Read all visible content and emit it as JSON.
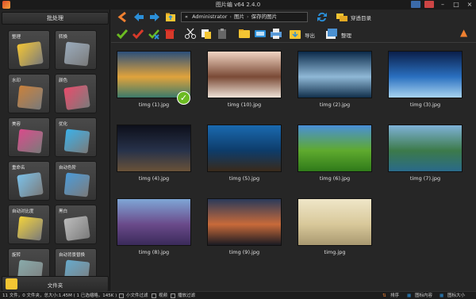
{
  "window": {
    "title": "图片编 v64 2.4.0"
  },
  "left_panel": {
    "header": "批处理",
    "tools": [
      {
        "label": "整理",
        "icon": "photos-stack-icon"
      },
      {
        "label": "转换",
        "icon": "convert-icon"
      },
      {
        "label": "水印",
        "icon": "watermark-stamp-icon"
      },
      {
        "label": "颜色",
        "icon": "color-balls-icon"
      },
      {
        "label": "美容",
        "icon": "cosmetics-icon"
      },
      {
        "label": "优化",
        "icon": "optimize-photo-icon"
      },
      {
        "label": "重命名",
        "icon": "rename-icon"
      },
      {
        "label": "自动色阶",
        "icon": "levels-chart-icon"
      },
      {
        "label": "自动对比度",
        "icon": "contrast-sun-icon"
      },
      {
        "label": "黑白",
        "icon": "grayscale-photo-icon"
      },
      {
        "label": "旋转",
        "icon": "rotate-icon"
      },
      {
        "label": "自动背景替换",
        "icon": "background-replace-icon"
      }
    ],
    "folder_label": "文件夹"
  },
  "toolbar": {
    "path": {
      "prefix": "«",
      "root": "Administrator",
      "parts": [
        "图片",
        "保存的图片"
      ]
    },
    "through_label": "穿透目录",
    "export_label": "导出",
    "organize_label": "整理"
  },
  "thumbnails": [
    {
      "name": "timg (1).jpg",
      "checked": true,
      "c1": "#2b4f7a",
      "c2": "#e0a33c",
      "c3": "#3c7a6a"
    },
    {
      "name": "timg (10).jpg",
      "checked": false,
      "c1": "#f2d6c4",
      "c2": "#7a4a36",
      "c3": "#efe3d8"
    },
    {
      "name": "timg (2).jpg",
      "checked": false,
      "c1": "#0b2a4a",
      "c2": "#8fb8d6",
      "c3": "#12304c"
    },
    {
      "name": "timg (3).jpg",
      "checked": false,
      "c1": "#0a1f4a",
      "c2": "#2a70c0",
      "c3": "#a8d4f0"
    },
    {
      "name": "timg (4).jpg",
      "checked": false,
      "c1": "#0d0f1a",
      "c2": "#27324a",
      "c3": "#6a5238"
    },
    {
      "name": "timg (5).jpg",
      "checked": false,
      "c1": "#1a6ab0",
      "c2": "#0d3c6a",
      "c3": "#3a2a1a"
    },
    {
      "name": "timg (6).jpg",
      "checked": false,
      "c1": "#4a8fd8",
      "c2": "#5faa2e",
      "c3": "#2f7a1a"
    },
    {
      "name": "timg (7).jpg",
      "checked": false,
      "c1": "#7fb2d8",
      "c2": "#3c7a4a",
      "c3": "#2a6a8a"
    },
    {
      "name": "timg (8).jpg",
      "checked": false,
      "c1": "#7fa6d6",
      "c2": "#6a4a8a",
      "c3": "#3a2a5a"
    },
    {
      "name": "timg (9).jpg",
      "checked": false,
      "c1": "#2a3a5a",
      "c2": "#c86a3a",
      "c3": "#1a1a22"
    },
    {
      "name": "timg.jpg",
      "checked": false,
      "c1": "#efe6c8",
      "c2": "#d8c89a",
      "c3": "#a89870"
    }
  ],
  "status": {
    "summary": "11 文件，0 文件夹，总大小:1.45M ( 1 已选缩略，145K )",
    "small_file_filter": "小文件过滤",
    "video": "视频",
    "sort_filter": "播放过滤",
    "sort": "排序",
    "thumb_content": "图标内容",
    "thumb_size": "图标大小"
  },
  "colors": {
    "accent_orange": "#f08030",
    "accent_blue": "#2b8fd8",
    "check_green": "#6bbb22"
  }
}
